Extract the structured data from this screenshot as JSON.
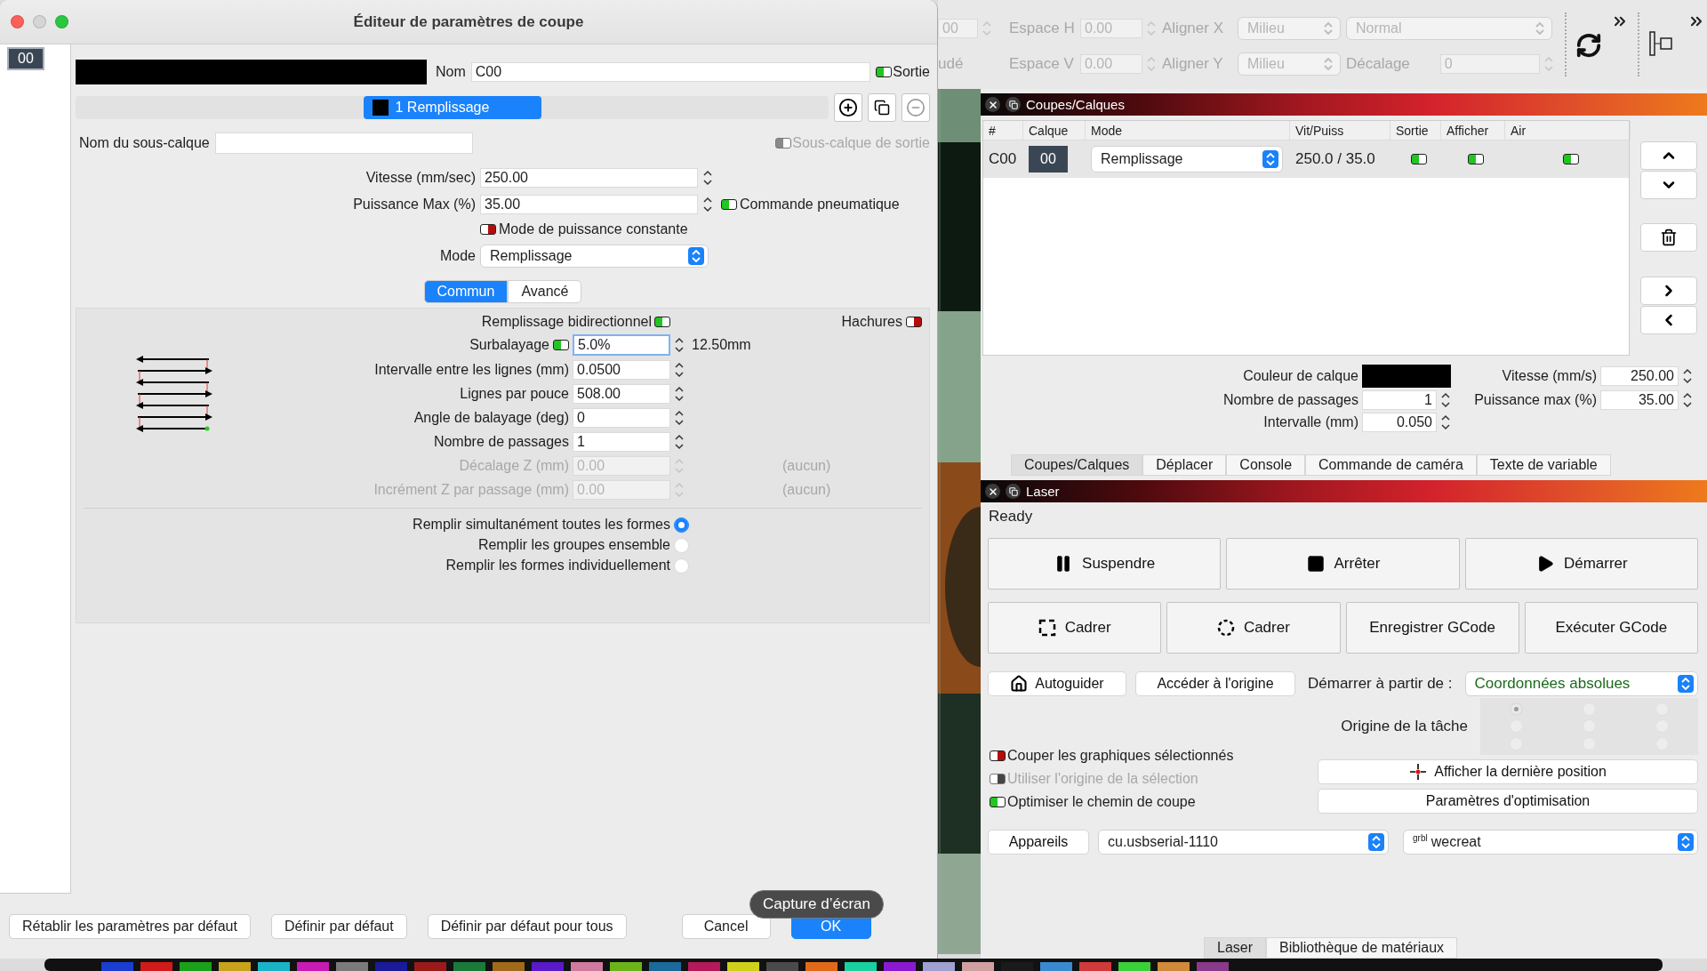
{
  "dialog": {
    "title": "Éditeur de paramètres de coupe",
    "layers": [
      {
        "label": "00",
        "selected": true
      }
    ],
    "name": {
      "label": "Nom",
      "value": "C00"
    },
    "output": {
      "label": "Sortie",
      "on": true,
      "disabled": false
    },
    "sublayers": [
      {
        "label": "1 Remplissage",
        "selected": true
      }
    ],
    "sublayer_name": {
      "label": "Nom du sous-calque"
    },
    "sublayer_output": {
      "label": "Sous-calque de sortie",
      "on": true,
      "disabled": true
    },
    "speed": {
      "label": "Vitesse (mm/sec)",
      "value": "250.00"
    },
    "power": {
      "label": "Puissance Max (%)",
      "value": "35.00"
    },
    "air_assist": {
      "label": "Commande pneumatique",
      "on": true,
      "disabled": false
    },
    "constant_power": {
      "label": "Mode de puissance constante",
      "on": false,
      "disabled": false
    },
    "mode": {
      "label": "Mode",
      "value": "Remplissage"
    },
    "tabs": [
      {
        "label": "Commun",
        "selected": true
      },
      {
        "label": "Avancé",
        "selected": false
      }
    ],
    "bidirectional": {
      "label": "Remplissage bidirectionnel",
      "on": true,
      "disabled": false
    },
    "crosshatch": {
      "label": "Hachures",
      "on": false,
      "disabled": false
    },
    "fields": [
      {
        "label": "Surbalayage",
        "value": "5.0%",
        "suffix": "12.50mm",
        "toggle_on": true,
        "focused": true,
        "disabled": false
      },
      {
        "label": "Intervalle entre les lignes (mm)",
        "value": "0.0500",
        "focused": false,
        "disabled": false
      },
      {
        "label": "Lignes par pouce",
        "value": "508.00",
        "focused": false,
        "disabled": false
      },
      {
        "label": "Angle de balayage (deg)",
        "value": "0",
        "focused": false,
        "disabled": false
      },
      {
        "label": "Nombre de passages",
        "value": "1",
        "focused": false,
        "disabled": false
      },
      {
        "label": "Décalage Z (mm)",
        "value": "0.00",
        "suffix": "(aucun)",
        "focused": false,
        "disabled": true
      },
      {
        "label": "Incrément Z par passage (mm)",
        "value": "0.00",
        "suffix": "(aucun)",
        "focused": false,
        "disabled": true
      }
    ],
    "fill_modes": [
      {
        "label": "Remplir simultanément toutes les formes",
        "selected": true
      },
      {
        "label": "Remplir les groupes ensemble",
        "selected": false
      },
      {
        "label": "Remplir les formes individuellement",
        "selected": false
      }
    ],
    "footer_left": [
      "Rétablir les paramètres par défaut",
      "Définir par défaut",
      "Définir par défaut pour tous"
    ],
    "footer_right": [
      {
        "label": "Cancel",
        "kind": "default"
      },
      {
        "label": "OK",
        "kind": "primary"
      }
    ]
  },
  "tooltip": "Capture d’écran",
  "toolbar": {
    "disabled": true,
    "row_1": [
      {
        "kind": "field",
        "value": "00"
      },
      {
        "kind": "label",
        "text": "Espace H"
      },
      {
        "kind": "field",
        "value": "0.00"
      },
      {
        "kind": "label",
        "text": "Aligner X"
      },
      {
        "kind": "select",
        "value": "Milieu"
      },
      {
        "kind": "select",
        "value": "Normal"
      }
    ],
    "row_2": [
      {
        "kind": "label",
        "text": "udé"
      },
      {
        "kind": "label",
        "text": "Espace V"
      },
      {
        "kind": "field",
        "value": "0.00"
      },
      {
        "kind": "label",
        "text": "Aligner Y"
      },
      {
        "kind": "select",
        "value": "Milieu"
      },
      {
        "kind": "label",
        "text": "Décalage"
      },
      {
        "kind": "field",
        "value": "0"
      }
    ]
  },
  "layers_panel": {
    "title": "Coupes/Calques",
    "columns": [
      "#",
      "Calque",
      "Mode",
      "Vit/Puiss",
      "Sortie",
      "Afficher",
      "Air"
    ],
    "rows": [
      {
        "id": "C00",
        "layer": "00",
        "mode": "Remplissage",
        "speed_power": "250.0 / 35.0",
        "output": true,
        "show": true,
        "air": true,
        "selected": true
      }
    ],
    "color_label": "Couleur de calque",
    "speed": {
      "label": "Vitesse (mm/s)",
      "value": "250.00"
    },
    "passes": {
      "label": "Nombre de passages",
      "value": "1"
    },
    "power": {
      "label": "Puissance max (%)",
      "value": "35.00"
    },
    "interval": {
      "label": "Intervalle (mm)",
      "value": "0.050"
    },
    "tabs": [
      {
        "label": "Coupes/Calques",
        "selected": true
      },
      {
        "label": "Déplacer",
        "selected": false
      },
      {
        "label": "Console",
        "selected": false
      },
      {
        "label": "Commande de caméra",
        "selected": false
      },
      {
        "label": "Texte de variable",
        "selected": false
      }
    ]
  },
  "laser_panel": {
    "title": "Laser",
    "status": "Ready",
    "main_buttons": [
      "Suspendre",
      "Arrêter",
      "Démarrer"
    ],
    "frame_buttons": [
      "Cadrer",
      "Cadrer",
      "Enregistrer GCode",
      "Exécuter GCode"
    ],
    "home_button": "Autoguider",
    "origin_button": "Accéder à l'origine",
    "start_from": {
      "label": "Démarrer à partir de :",
      "value": "Coordonnées absolues"
    },
    "job_origin": {
      "label": "Origine de la tâche",
      "points": [
        {
          "selected": true
        },
        {
          "selected": false
        },
        {
          "selected": false
        },
        {
          "selected": false
        },
        {
          "selected": false
        },
        {
          "selected": false
        },
        {
          "selected": false
        },
        {
          "selected": false
        },
        {
          "selected": false
        }
      ]
    },
    "options": [
      {
        "label": "Couper les graphiques sélectionnés",
        "on": false,
        "disabled": false
      },
      {
        "label": "Utiliser l'origine de la sélection",
        "on": false,
        "disabled": true
      },
      {
        "label": "Optimiser le chemin de coupe",
        "on": true,
        "disabled": false
      }
    ],
    "position_button": "Afficher la dernière position",
    "optimization_button": "Paramètres d'optimisation",
    "devices_button": "Appareils",
    "port": "cu.usbserial-1110",
    "device": {
      "tag": "grbl",
      "name": "wecreat"
    },
    "tabs": [
      {
        "label": "Laser",
        "selected": true
      },
      {
        "label": "Bibliothèque de matériaux",
        "selected": false
      }
    ]
  }
}
